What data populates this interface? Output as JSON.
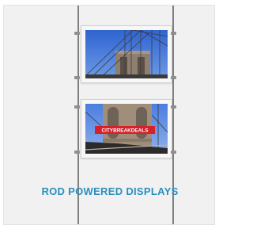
{
  "caption": "ROD POWERED DISPLAYS",
  "bottom_image": {
    "overlay_text": "CITYBREAKDEALS"
  },
  "colors": {
    "caption": "#2b8fbd",
    "overlay_red": "#d6202a",
    "sky_blue": "#3c6fd6"
  }
}
